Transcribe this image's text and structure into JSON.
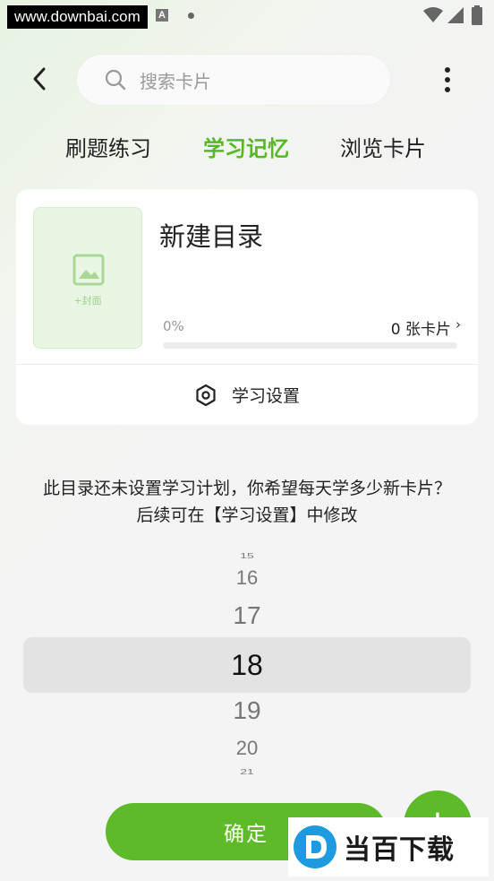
{
  "status_bar": {
    "watermark": "www.downbai.com",
    "indicator": "A"
  },
  "search": {
    "placeholder": "搜索卡片"
  },
  "tabs": [
    {
      "label": "刷题练习",
      "active": false
    },
    {
      "label": "学习记忆",
      "active": true
    },
    {
      "label": "浏览卡片",
      "active": false
    }
  ],
  "card": {
    "cover_label": "+封面",
    "title": "新建目录",
    "progress_percent": "0%",
    "progress_value": 0,
    "card_count": "0 张卡片",
    "settings_label": "学习设置"
  },
  "prompt": {
    "line1": "此目录还未设置学习计划，你希望每天学多少新卡片？",
    "line2": "后续可在【学习设置】中修改"
  },
  "picker": {
    "values": [
      "15",
      "16",
      "17",
      "18",
      "19",
      "20",
      "21"
    ],
    "selected": "18"
  },
  "confirm_label": "确定",
  "add_label": "+",
  "brand": {
    "text": "当百下载"
  },
  "colors": {
    "accent": "#58b826",
    "button": "#5dbb2a"
  }
}
